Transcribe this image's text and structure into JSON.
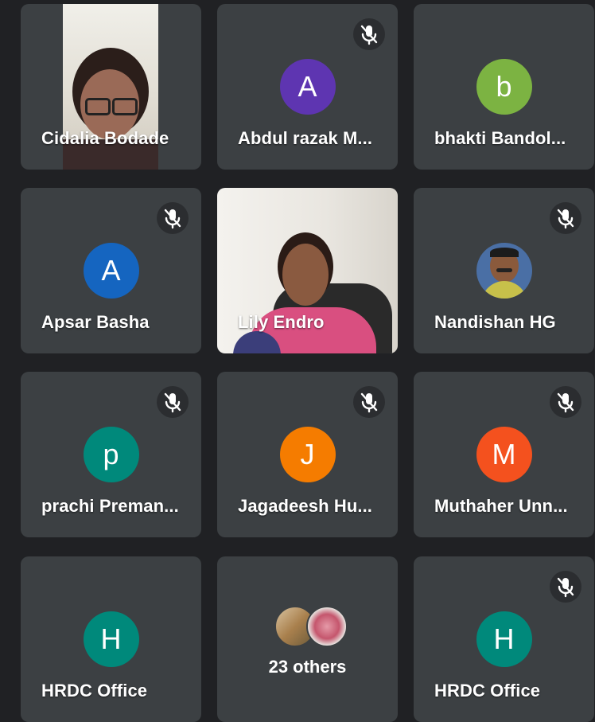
{
  "tiles": [
    {
      "name": "Cidalia Bodade",
      "type": "video",
      "muted": false
    },
    {
      "name": "Abdul razak M...",
      "initial": "A",
      "color": "#5e35b1",
      "muted": true
    },
    {
      "name": "bhakti Bandol...",
      "initial": "b",
      "color": "#7cb342",
      "muted": false
    },
    {
      "name": "Apsar Basha",
      "initial": "A",
      "color": "#1565c0",
      "muted": true
    },
    {
      "name": "Lily Endro",
      "type": "video",
      "muted": false
    },
    {
      "name": "Nandishan HG",
      "type": "photo",
      "muted": true
    },
    {
      "name": "prachi Preman...",
      "initial": "p",
      "color": "#00897b",
      "muted": true
    },
    {
      "name": "Jagadeesh Hu...",
      "initial": "J",
      "color": "#f57c00",
      "muted": true
    },
    {
      "name": "Muthaher Unn...",
      "initial": "M",
      "color": "#f4511e",
      "muted": true
    },
    {
      "name": "HRDC Office",
      "initial": "H",
      "color": "#00897b",
      "muted": false
    },
    {
      "name": "23 others",
      "type": "others"
    },
    {
      "name": "HRDC Office",
      "initial": "H",
      "color": "#00897b",
      "muted": true
    }
  ]
}
